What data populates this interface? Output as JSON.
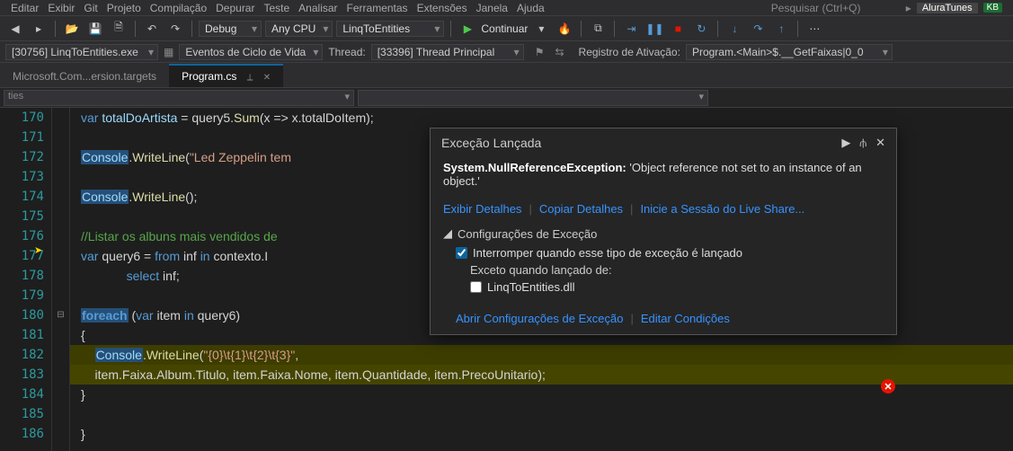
{
  "menu": {
    "items": [
      "Editar",
      "Exibir",
      "Git",
      "Projeto",
      "Compilação",
      "Depurar",
      "Teste",
      "Analisar",
      "Ferramentas",
      "Extensões",
      "Janela",
      "Ajuda"
    ],
    "search_placeholder": "Pesquisar (Ctrl+Q)",
    "app_label": "AluraTunes"
  },
  "toolbar": {
    "debug": "Debug",
    "cpu": "Any CPU",
    "project": "LinqToEntities",
    "continue": "Continuar"
  },
  "toolbar2": {
    "process": "[30756] LinqToEntities.exe",
    "lifecycle": "Eventos de Ciclo de Vida",
    "thread_label": "Thread:",
    "thread": "[33396] Thread Principal",
    "stack_label": "Registro de Ativação:",
    "stack": "Program.<Main>$.__GetFaixas|0_0"
  },
  "tabs": [
    {
      "label": "Microsoft.Com...ersion.targets",
      "active": false
    },
    {
      "label": "Program.cs",
      "active": true
    }
  ],
  "filterbar": {
    "left": "ties"
  },
  "code": {
    "lines_start": 170,
    "lines": [
      {
        "n": 170,
        "t": "var totalDoArtista = query5.Sum(x => x.totalDoItem);"
      },
      {
        "n": 171,
        "t": ""
      },
      {
        "n": 172,
        "t": "Console.WriteLine(\"Led Zeppelin tem"
      },
      {
        "n": 173,
        "t": ""
      },
      {
        "n": 174,
        "t": "Console.WriteLine();"
      },
      {
        "n": 175,
        "t": ""
      },
      {
        "n": 176,
        "t": "//Listar os albuns mais vendidos de"
      },
      {
        "n": 177,
        "t": "var query6 = from inf in contexto.I"
      },
      {
        "n": 178,
        "t": "             select inf;"
      },
      {
        "n": 179,
        "t": ""
      },
      {
        "n": 180,
        "t": "foreach (var item in query6)"
      },
      {
        "n": 181,
        "t": "{"
      },
      {
        "n": 182,
        "t": "    Console.WriteLine(\"{0}\\t{1}\\t{2}\\t{3}\","
      },
      {
        "n": 183,
        "t": "    item.Faixa.Album.Titulo, item.Faixa.Nome, item.Quantidade, item.PrecoUnitario);"
      },
      {
        "n": 184,
        "t": "}"
      },
      {
        "n": 185,
        "t": ""
      },
      {
        "n": 186,
        "t": "}"
      }
    ]
  },
  "exception": {
    "header": "Exceção Lançada",
    "type": "System.NullReferenceException:",
    "message": "'Object reference not set to an instance of an object.'",
    "link_details": "Exibir Detalhes",
    "link_copy": "Copiar Detalhes",
    "link_liveshare": "Inicie a Sessão do Live Share...",
    "settings_title": "Configurações de Exceção",
    "chk_break": "Interromper quando esse tipo de exceção é lançado",
    "except_from": "Exceto quando lançado de:",
    "dll": "LinqToEntities.dll",
    "link_open_settings": "Abrir Configurações de Exceção",
    "link_edit": "Editar Condições"
  }
}
